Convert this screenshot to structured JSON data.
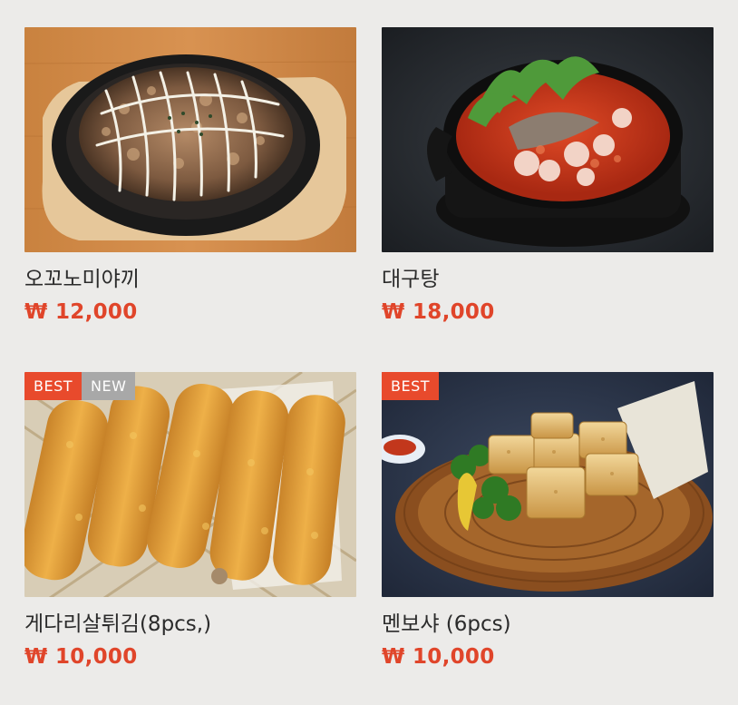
{
  "menu": {
    "items": [
      {
        "name": "오꼬노미야끼",
        "price": "₩ 12,000",
        "badges": []
      },
      {
        "name": "대구탕",
        "price": "₩ 18,000",
        "badges": []
      },
      {
        "name": "게다리살튀김(8pcs,)",
        "price": "₩ 10,000",
        "badges": [
          "BEST",
          "NEW"
        ]
      },
      {
        "name": "멘보샤 (6pcs)",
        "price": "₩ 10,000",
        "badges": [
          "BEST"
        ]
      }
    ]
  },
  "colors": {
    "background": "#ecebe9",
    "price": "#e0452a",
    "best_badge": "#e84a2c",
    "new_badge": "#a8a8a8"
  }
}
